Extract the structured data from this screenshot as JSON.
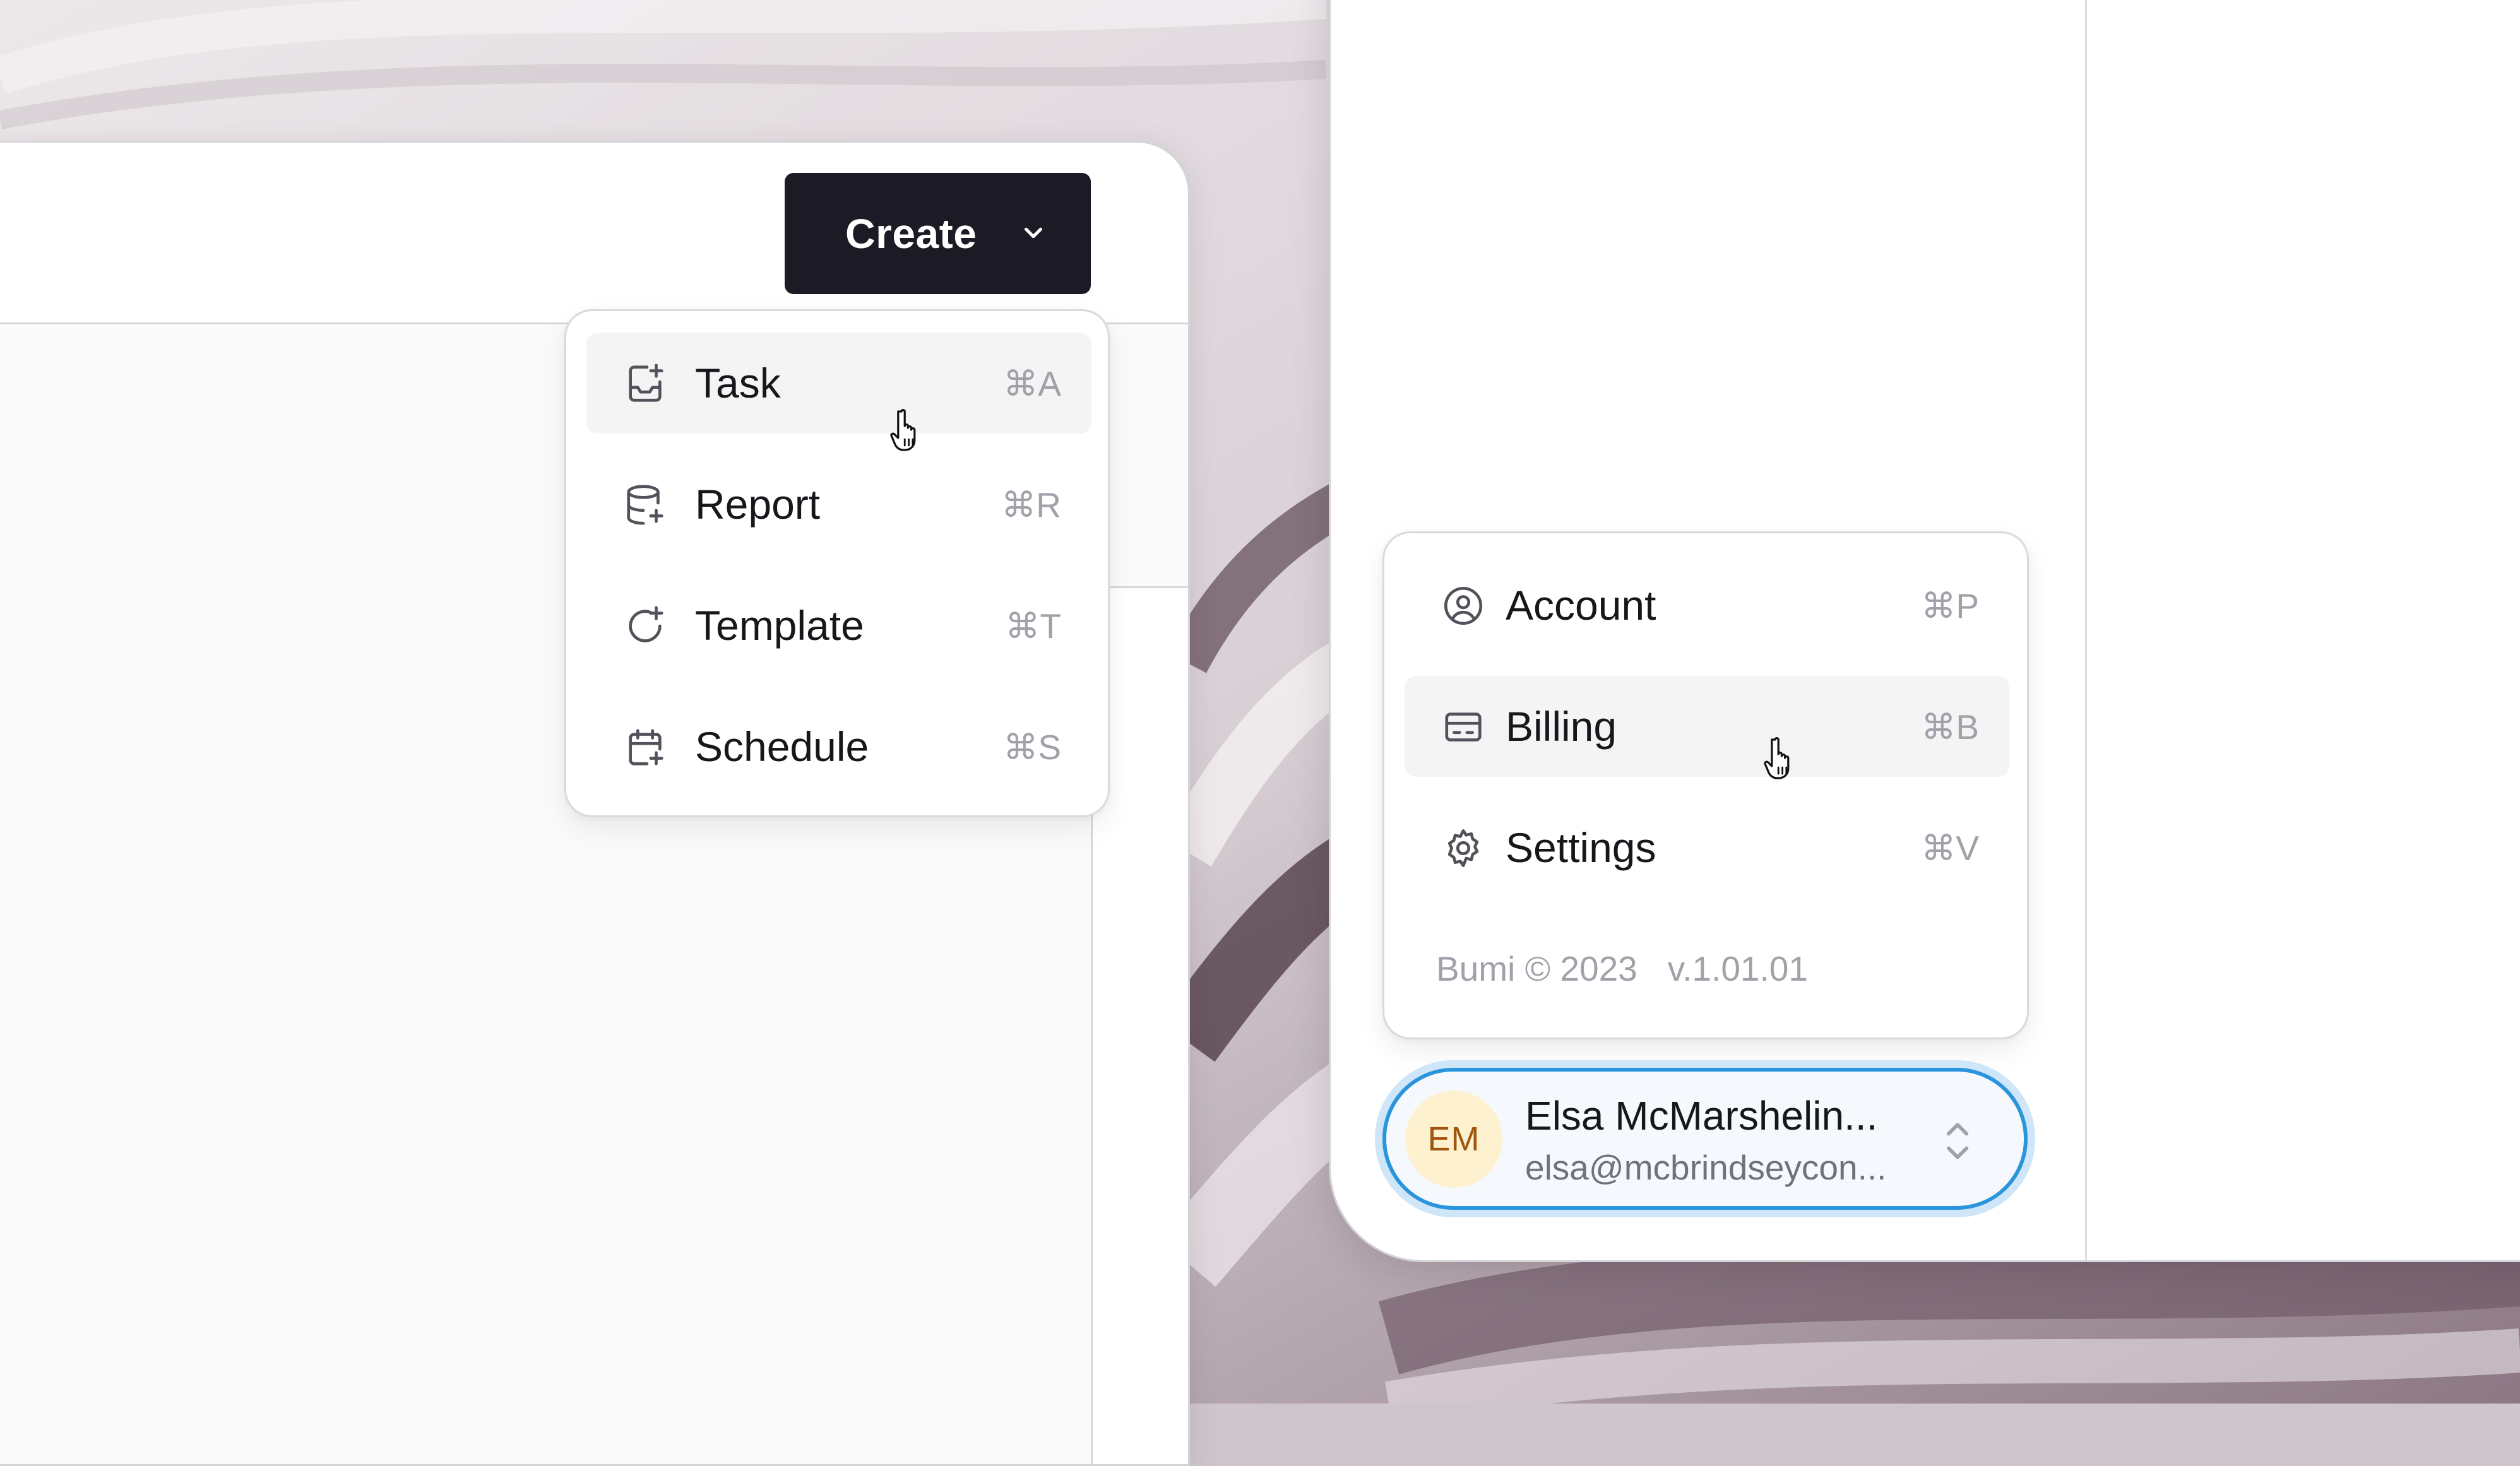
{
  "create_menu": {
    "button_label": "Create",
    "items": [
      {
        "label": "Task",
        "shortcut": "⌘A",
        "icon": "inbox-plus-icon"
      },
      {
        "label": "Report",
        "shortcut": "⌘R",
        "icon": "database-plus-icon"
      },
      {
        "label": "Template",
        "shortcut": "⌘T",
        "icon": "refresh-icon"
      },
      {
        "label": "Schedule",
        "shortcut": "⌘S",
        "icon": "calendar-plus-icon"
      }
    ]
  },
  "account_menu": {
    "items": [
      {
        "label": "Account",
        "shortcut": "⌘P",
        "icon": "user-circle-icon"
      },
      {
        "label": "Billing",
        "shortcut": "⌘B",
        "icon": "credit-card-icon"
      },
      {
        "label": "Settings",
        "shortcut": "⌘V",
        "icon": "gear-icon"
      }
    ],
    "footer": {
      "copyright": "Bumi © 2023",
      "version": "v.1.01.01"
    }
  },
  "user": {
    "initials": "EM",
    "name": "Elsa McMarshelin...",
    "email": "elsa@mcbrindseycon..."
  },
  "colors": {
    "primary_button": "#1c1a24",
    "focus_ring": "#2a95dc",
    "avatar_bg": "#fdf1cf",
    "avatar_text": "#a0560f"
  }
}
